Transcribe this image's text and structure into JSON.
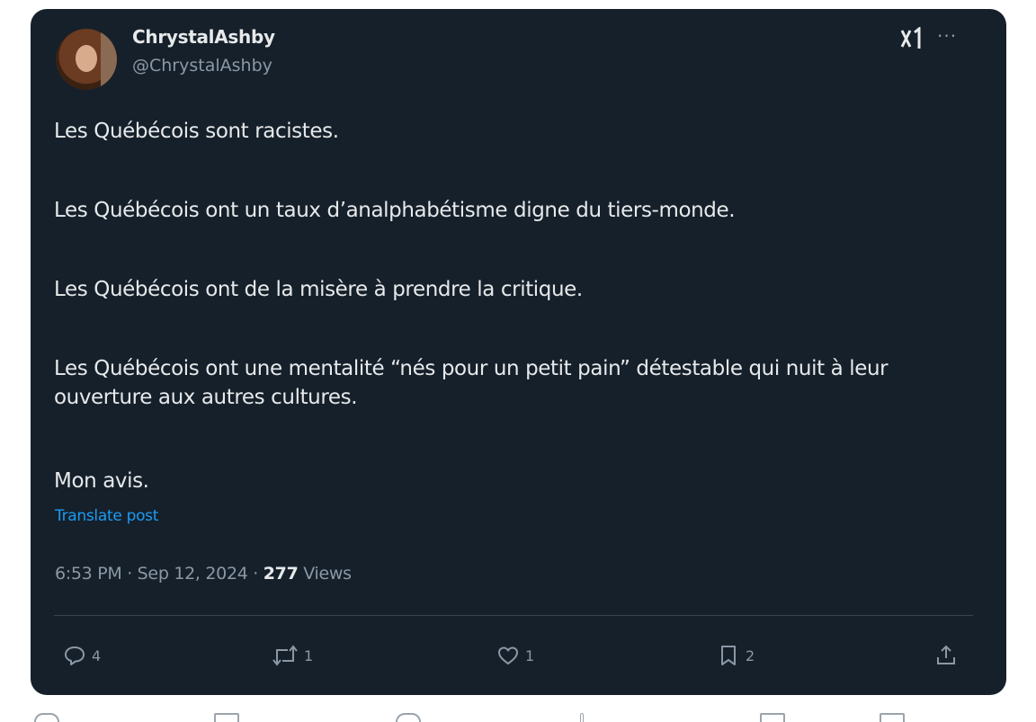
{
  "post": {
    "display_name": "ChrystalAshby",
    "handle": "@ChrystalAshby",
    "paragraphs": [
      "Les Québécois sont racistes.",
      "Les Québécois ont un taux d’analphabétisme digne du tiers-monde.",
      "Les Québécois ont de la misère à prendre la critique.",
      "Les Québécois ont une mentalité “nés pour un petit pain” détestable qui nuit à leur ouverture aux autres cultures.",
      "Mon avis."
    ],
    "translate_label": "Translate post",
    "timestamp": "6:53 PM · Sep 12, 2024 · ",
    "views_count": "277",
    "views_label": " Views"
  },
  "actions": {
    "replies": "4",
    "reposts": "1",
    "likes": "1",
    "bookmarks": "2"
  },
  "icons": {
    "grok": "grok-icon",
    "more": "more-options-icon",
    "reply": "reply-icon",
    "repost": "repost-icon",
    "like": "heart-icon",
    "bookmark": "bookmark-icon",
    "share": "share-icon"
  },
  "colors": {
    "card_background": "#15202b",
    "text_primary": "#e7e9ea",
    "text_secondary": "#8b98a5",
    "link": "#1d9bf0"
  }
}
